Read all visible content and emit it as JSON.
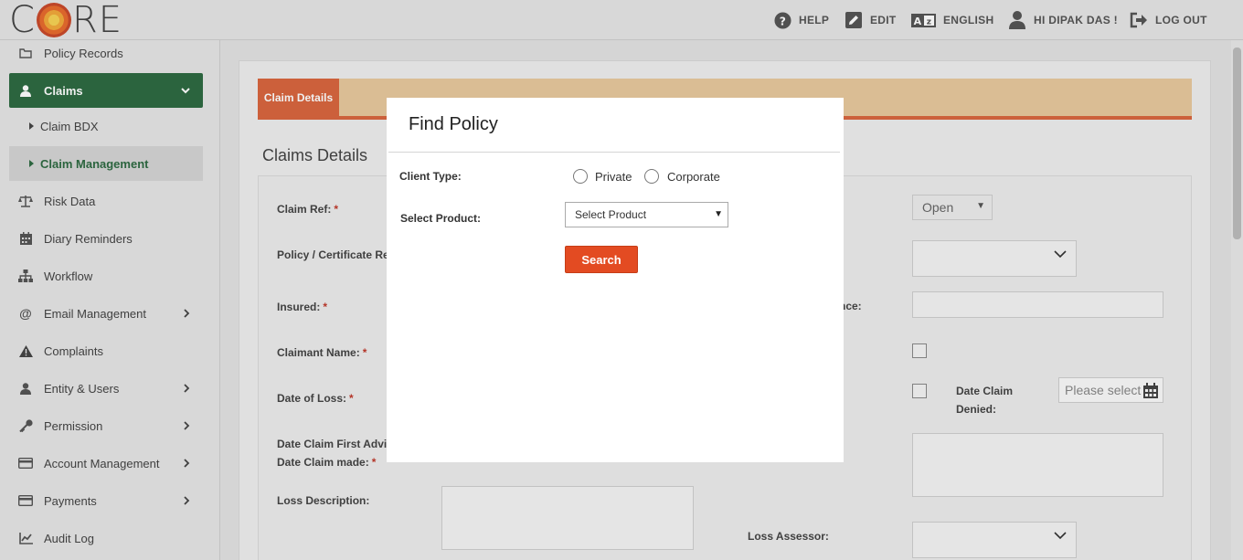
{
  "header": {
    "logo": {
      "left": "C",
      "right": "RE"
    },
    "help": "HELP",
    "edit": "EDIT",
    "language": "ENGLISH",
    "user": "HI DIPAK DAS !",
    "logout": "LOG OUT"
  },
  "sidebar": {
    "items": [
      {
        "label": "Policy Records"
      },
      {
        "label": "Claims"
      },
      {
        "label": "Claim BDX"
      },
      {
        "label": "Claim Management"
      },
      {
        "label": "Risk Data"
      },
      {
        "label": "Diary Reminders"
      },
      {
        "label": "Workflow"
      },
      {
        "label": "Email Management"
      },
      {
        "label": "Complaints"
      },
      {
        "label": "Entity & Users"
      },
      {
        "label": "Permission"
      },
      {
        "label": "Account Management"
      },
      {
        "label": "Payments"
      },
      {
        "label": "Audit Log"
      }
    ]
  },
  "main": {
    "tab_label": "Claim Details",
    "section_title": "Claims Details",
    "form": {
      "claim_ref": "Claim Ref:",
      "policy_ref": "Policy / Certificate Re",
      "insured": "Insured:",
      "claimant_name": "Claimant Name:",
      "date_of_loss": "Date of Loss:",
      "date_first_advice": "Date Claim First Advi",
      "date_claim_made": "Date Claim made:",
      "loss_description": "Loss Description:",
      "status_value": "Open",
      "reference_partial": "nce:",
      "date_claim_denied": "Date Claim Denied:",
      "date_placeholder": "Please select",
      "loss_assessor": "Loss Assessor:",
      "required_mark": "*"
    }
  },
  "modal": {
    "title": "Find Policy",
    "client_type_label": "Client Type:",
    "options": [
      "Private",
      "Corporate"
    ],
    "select_product_label": "Select Product:",
    "product_placeholder": "Select Product",
    "search_button": "Search"
  },
  "colors": {
    "sidebar_active": "#2e6b42",
    "tab_active": "#d9673f",
    "tab_bar": "#e8c99e",
    "search_button": "#e34b22",
    "required": "#c0392b"
  }
}
